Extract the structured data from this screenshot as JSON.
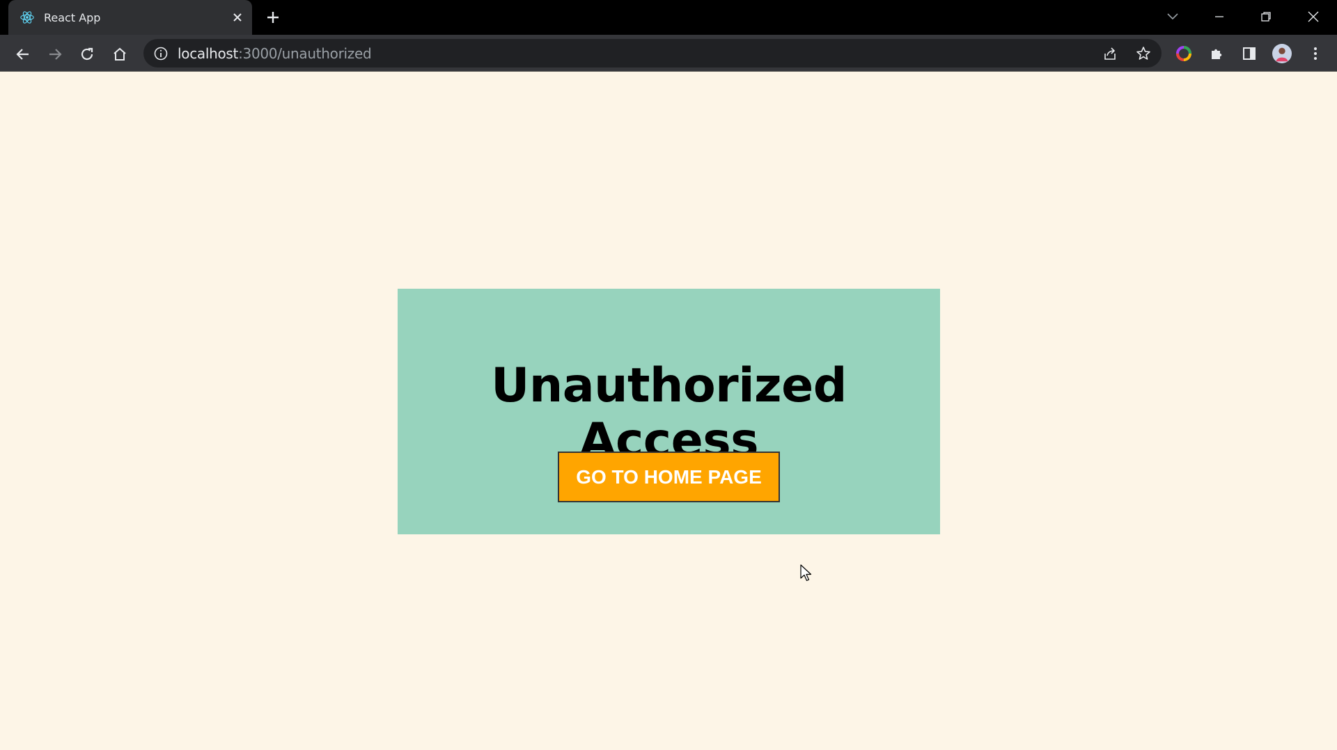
{
  "browser": {
    "tab": {
      "title": "React App",
      "favicon": "react-logo-icon"
    },
    "omnibox": {
      "host": "localhost",
      "path": ":3000/unauthorized"
    },
    "colors": {
      "frame": "#000000",
      "toolbar": "#35363a",
      "omnibox": "#202124"
    }
  },
  "page": {
    "heading": "Unauthorized Access",
    "home_button_label": "GO TO HOME PAGE",
    "colors": {
      "background": "#fdf5e7",
      "card": "#97d3bd",
      "button": "#ffa500"
    }
  }
}
